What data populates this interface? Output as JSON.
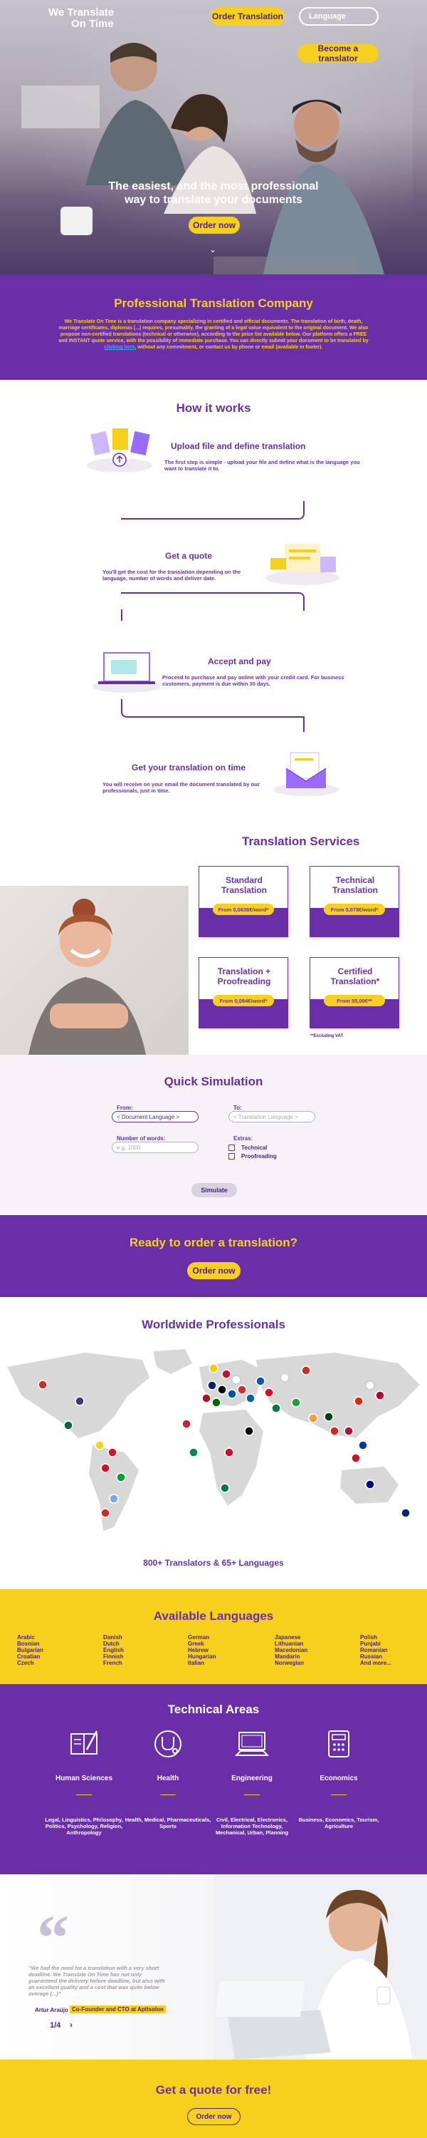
{
  "header": {
    "logo_line1": "We Translate",
    "logo_line2": "On Time",
    "order_button": "Order Translation",
    "language_button": "Language",
    "translator_button": "Become a translator"
  },
  "hero": {
    "title_line1": "The easiest, and the most professional",
    "title_line2": "way to translate your documents",
    "order_button": "Order now",
    "scroll_icon": "chevron-down-icon"
  },
  "company": {
    "title": "Professional Translation Company",
    "text_before_link": "We Translate On Time is a translation company specializing in certified and official documents. The translation of birth, death, marriage certificates, diplomas (...) requires, presumably, the granting of a legal value equivalent to the original document. We also propose non-certified translations (technical or otherwise), according to the price list available below. Our platform offers a FREE and INSTANT quote service, with the possibility of immediate purchase. You can directly submit your document to be translated by ",
    "link_text": "clicking here",
    "text_after_link": ", without any commitment, or contact us by phone or email (available in footer)."
  },
  "how": {
    "title": "How it works",
    "steps": [
      {
        "title": "Upload file and define translation",
        "text": "The first step is simple - upload your file and define what is the language you want to translate it to."
      },
      {
        "title": "Get a quote",
        "text": "You'll get the cost for the translation depending on the language, number of words and deliver date."
      },
      {
        "title": "Accept and pay",
        "text": "Proceed to purchase and pay online with your credit card. For business customers, payment is due within 30 days."
      },
      {
        "title": "Get your translation on time",
        "text": "You will receive on your email the document translated by our professionals, just in time."
      }
    ]
  },
  "services": {
    "title": "Translation Services",
    "cards": [
      {
        "line1": "Standard",
        "line2": "Translation",
        "price": "From 0,0636€/word*"
      },
      {
        "line1": "Technical",
        "line2": "Translation",
        "price": "From 0,078€/word*"
      },
      {
        "line1": "Translation +",
        "line2": "Proofreading",
        "price": "From 0,084€/word*"
      },
      {
        "line1": "Certified",
        "line2": "Translation*",
        "price": "From 55,00€**"
      }
    ],
    "vat_note": "**Excluding VAT"
  },
  "quick": {
    "title": "Quick Simulation",
    "from_label": "From:",
    "from_value": "< Document Language >",
    "to_label": "To:",
    "to_value": "< Translation Language >",
    "words_label": "Number of words:",
    "words_placeholder": "e.g. 1000",
    "extras_label": "Extras:",
    "extra1": "Technical",
    "extra2": "Proofreading",
    "simulate_button": "Simulate"
  },
  "ready": {
    "title": "Ready to order a translation?",
    "button": "Order now"
  },
  "world": {
    "title": "Worldwide Professionals",
    "count": "800+ Translators & 65+ Languages"
  },
  "languages": {
    "title": "Available Languages",
    "columns": [
      [
        "Arabic",
        "Bosnian",
        "Bulgarian",
        "Croatian",
        "Czech"
      ],
      [
        "Danish",
        "Dutch",
        "English",
        "Finnish",
        "French"
      ],
      [
        "German",
        "Greek",
        "Hebrew",
        "Hungarian",
        "Italian"
      ],
      [
        "Japanese",
        "Lithuanian",
        "Macedonian",
        "Mandarin",
        "Norwegian"
      ],
      [
        "Polish",
        "Punjabi",
        "Romanian",
        "Russian",
        "And more..."
      ]
    ]
  },
  "technical": {
    "title": "Technical Areas",
    "areas": [
      {
        "icon": "book-pen-icon",
        "title": "Human Sciences",
        "text": "Legal, Linguistics, Philosophy, Politics, Psychology, Religion, Anthropology"
      },
      {
        "icon": "stethoscope-icon",
        "title": "Health",
        "text": "Health, Medical, Pharmaceuticals, Sports"
      },
      {
        "icon": "computer-icon",
        "title": "Engineering",
        "text": "Civil, Electrical, Electronics, Information Technology, Mechanical, Urban, Planning"
      },
      {
        "icon": "calculator-icon",
        "title": "Economics",
        "text": "Business, Economics, Tourism, Agriculture"
      }
    ]
  },
  "testimonial": {
    "quote": "\"We had the need for a translation with a very short deadline. We Translate On Time has not only guaranteed the delivery before deadline, but also with an excellent quality and a cost that was quite below average (...)\"",
    "author": "Artur Araújo",
    "role": "Co-Founder and CTO at AptIsolon",
    "page": "1/4"
  },
  "footer_quote": {
    "title": "Get a quote for free!",
    "button": "Order now"
  },
  "colors": {
    "purple": "#6a2fa8",
    "yellow": "#f7cf1d",
    "link_blue": "#2ab5ff"
  }
}
